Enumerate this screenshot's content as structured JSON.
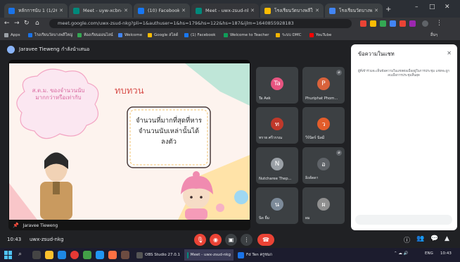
{
  "browser": {
    "tabs": [
      {
        "title": "หลักการนับ 1 (1/260)",
        "color": "#1a73e8"
      },
      {
        "title": "Meet - uyw-xcbn-nkg",
        "color": "#00897b"
      },
      {
        "title": "(10) Facebook",
        "color": "#1877f2"
      },
      {
        "title": "Meet - uwx-zsud-nkg",
        "color": "#00897b"
      },
      {
        "title": "โรงเรียนวัดบางพลีใหญ่กลาง",
        "color": "#fbbc04"
      },
      {
        "title": "โรงเรียนวัดบางพลี",
        "color": "#4285f4"
      }
    ],
    "new_tab": "+",
    "window_controls": [
      "–",
      "□",
      "✕"
    ],
    "url": "meet.google.com/uwx-zsud-nkg?pli=1&authuser=1&hs=179&hs=122&hs=187&ijlm=1640855928183",
    "bookmarks": [
      {
        "label": "Apps",
        "color": "#9aa0a6"
      },
      {
        "label": "โรงเรียนวัดบางพลีใหญ่",
        "color": "#1a73e8"
      },
      {
        "label": "ห้องเรียนออนไลน์",
        "color": "#34a853"
      },
      {
        "label": "Welcome",
        "color": "#4285f4"
      },
      {
        "label": "Google สไลด์",
        "color": "#fbbc04"
      },
      {
        "label": "(1) Facebook",
        "color": "#1877f2"
      },
      {
        "label": "Welcome to Teacher",
        "color": "#0f9d58"
      },
      {
        "label": "ระบบ DMC",
        "color": "#f4b400"
      },
      {
        "label": "YouTube",
        "color": "#ff0000"
      }
    ],
    "bookmarks_other": "อื่นๆ"
  },
  "meet": {
    "presenter_label": "Jaravee Tieweng กำลังนำเสนอ",
    "slide": {
      "title": "ทบทวน",
      "cloud_text": "ส.ต.ม. ของจำนวนนับมากกว่าหรือเท่ากับ",
      "box_text": "จำนวนที่มากที่สุดที่หารจำนวนนับเหล่านั้นได้ลงตัว"
    },
    "presenter_name": "Jaravee Tieweng",
    "participants": [
      {
        "name": "Ta Aek",
        "initial": "Ta",
        "color": "#e75480"
      },
      {
        "name": "Phuriphat Phom...",
        "initial": "P",
        "color": "#d9623b"
      },
      {
        "name": "ทราย ศรีวรรณ",
        "initial": "ท",
        "color": "#c0392b"
      },
      {
        "name": "วีร์นิตร์ นิลมี",
        "initial": "ว",
        "color": "#e35d2b"
      },
      {
        "name": "Nutcharee Thep...",
        "initial": "N",
        "color": "#9aa0a6"
      },
      {
        "name": "อิงลัดดา",
        "initial": "อ",
        "color": "#5f6368"
      },
      {
        "name": "นิด ยิ้ม",
        "initial": "น",
        "color": "#7c8a99"
      },
      {
        "name": "ผม",
        "initial": "ผ",
        "color": "#8f8f8f"
      }
    ],
    "chat": {
      "title": "ข้อความในแชท",
      "note": "ผู้ที่เข้าร่วมจะเห็นข้อความในแชทต่อเมื่ออยู่ในการประชุม แชทจะถูกลบเมื่อการประชุมสิ้นสุด",
      "close": "✕"
    },
    "time": "10:43",
    "meeting_code": "uwx-zsud-nkg",
    "controls": [
      {
        "label": "mic off",
        "glyph": "🎙",
        "color": "#ea4335"
      },
      {
        "label": "camera off",
        "glyph": "◉",
        "color": "#ea4335"
      },
      {
        "label": "present",
        "glyph": "▣",
        "color": "#3c4043"
      },
      {
        "label": "more",
        "glyph": "⋮",
        "color": "#3c4043"
      },
      {
        "label": "leave",
        "glyph": "☎",
        "color": "#ea4335"
      }
    ],
    "right_controls": [
      "ⓘ",
      "👥",
      "💬",
      "▲"
    ]
  },
  "taskbar": {
    "search": "⌕",
    "apps": [
      {
        "label": "OBS Studio 27.0.1",
        "color": "#555"
      },
      {
        "label": "Meet - uwx-zsud-nkg",
        "color": "#00897b"
      },
      {
        "label": "Fd Ten ครูชนก",
        "color": "#1a73e8"
      }
    ],
    "tray_time": "10:43",
    "tray_lang": "ENG"
  }
}
